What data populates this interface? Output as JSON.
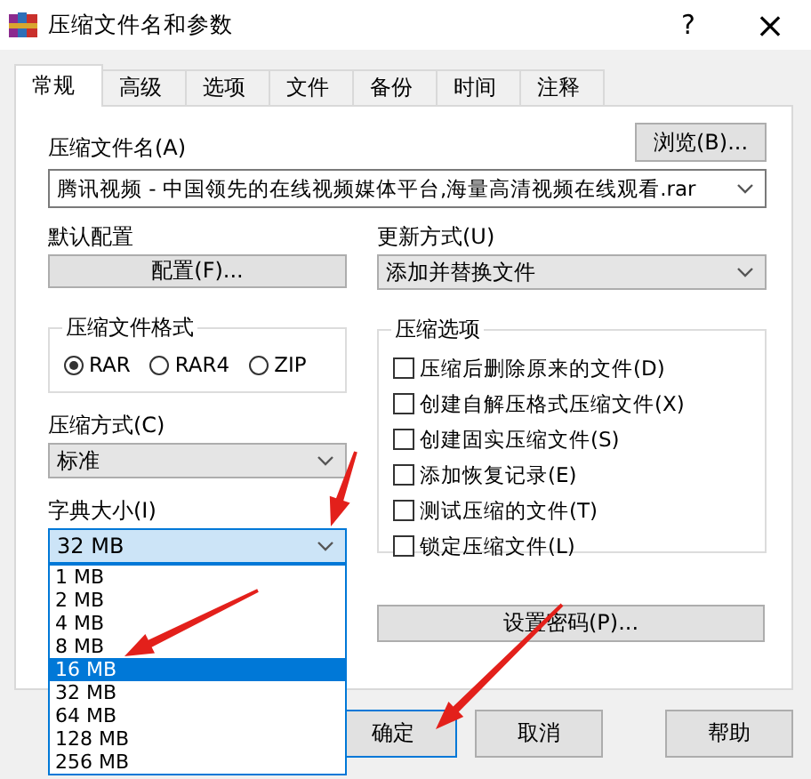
{
  "window": {
    "title": "压缩文件名和参数",
    "help_glyph": "?",
    "close_glyph": "×"
  },
  "tabs": [
    {
      "label": "常规",
      "selected": true
    },
    {
      "label": "高级",
      "selected": false
    },
    {
      "label": "选项",
      "selected": false
    },
    {
      "label": "文件",
      "selected": false
    },
    {
      "label": "备份",
      "selected": false
    },
    {
      "label": "时间",
      "selected": false
    },
    {
      "label": "注释",
      "selected": false
    }
  ],
  "archive_name": {
    "label": "压缩文件名(A)",
    "browse_button": "浏览(B)...",
    "value": "腾讯视频 - 中国领先的在线视频媒体平台,海量高清视频在线观看.rar"
  },
  "profiles": {
    "label": "默认配置",
    "button": "配置(F)..."
  },
  "update_mode": {
    "label": "更新方式(U)",
    "value": "添加并替换文件"
  },
  "archive_format": {
    "legend": "压缩文件格式",
    "options": [
      {
        "label": "RAR",
        "selected": true
      },
      {
        "label": "RAR4",
        "selected": false
      },
      {
        "label": "ZIP",
        "selected": false
      }
    ]
  },
  "compression_method": {
    "label": "压缩方式(C)",
    "value": "标准"
  },
  "dictionary_size": {
    "label": "字典大小(I)",
    "value": "32 MB",
    "expanded": true,
    "options": [
      {
        "label": "1 MB",
        "highlighted": false
      },
      {
        "label": "2 MB",
        "highlighted": false
      },
      {
        "label": "4 MB",
        "highlighted": false
      },
      {
        "label": "8 MB",
        "highlighted": false
      },
      {
        "label": "16 MB",
        "highlighted": true
      },
      {
        "label": "32 MB",
        "highlighted": false
      },
      {
        "label": "64 MB",
        "highlighted": false
      },
      {
        "label": "128 MB",
        "highlighted": false
      },
      {
        "label": "256 MB",
        "highlighted": false
      }
    ]
  },
  "archiving_options": {
    "legend": "压缩选项",
    "items": [
      {
        "label": "压缩后删除原来的文件(D)",
        "checked": false
      },
      {
        "label": "创建自解压格式压缩文件(X)",
        "checked": false
      },
      {
        "label": "创建固实压缩文件(S)",
        "checked": false
      },
      {
        "label": "添加恢复记录(E)",
        "checked": false
      },
      {
        "label": "测试压缩的文件(T)",
        "checked": false
      },
      {
        "label": "锁定压缩文件(L)",
        "checked": false
      }
    ]
  },
  "password_button": "设置密码(P)...",
  "buttons": [
    {
      "label": "确定",
      "default": true
    },
    {
      "label": "取消",
      "default": false
    },
    {
      "label": "帮助",
      "default": false
    }
  ]
}
